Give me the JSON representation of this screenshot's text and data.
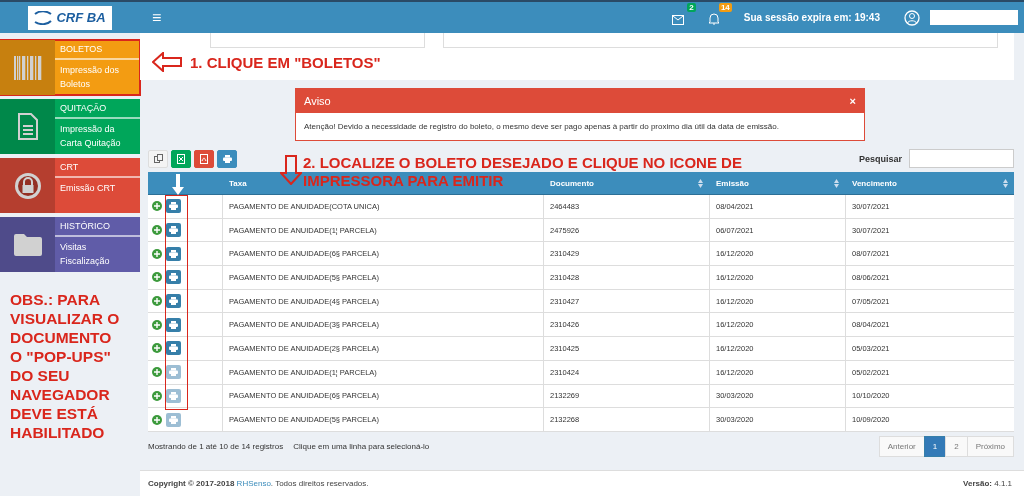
{
  "topbar": {
    "logo": "CRF BA",
    "menu_glyph": "≡",
    "mail_badge": "2",
    "bell_badge": "14",
    "session": "Sua sessão expira em: 19:43"
  },
  "sidebar": {
    "items": [
      {
        "kind": "barcode",
        "title": "BOLETOS",
        "subtitle": "Impressão dos Boletos",
        "color": "#f39c12",
        "highlighted": true
      },
      {
        "kind": "document",
        "title": "QUITAÇÃO",
        "subtitle": "Impressão da Carta Quitação",
        "color": "#00a65a",
        "highlighted": false
      },
      {
        "kind": "lock",
        "title": "CRT",
        "subtitle": "Emissão CRT",
        "color": "#dd4b39",
        "highlighted": false
      },
      {
        "kind": "folder",
        "title": "HISTÓRICO",
        "subtitle": "Visitas Fiscalização",
        "color": "#605ca8",
        "highlighted": false
      }
    ]
  },
  "annotations": {
    "step1": "1. CLIQUE EM \"BOLETOS\"",
    "step2": [
      "2. LOCALIZE O BOLETO DESEJADO E CLIQUE NO ICONE DE",
      "IMPRESSORA PARA EMITIR"
    ],
    "note": [
      "OBS.: PARA",
      "VISUALIZAR O",
      "DOCUMENTO",
      "O \"POP-UPS\"",
      "DO SEU",
      "NAVEGADOR",
      "DEVE ESTÁ",
      "HABILITADO"
    ]
  },
  "alert": {
    "title": "Aviso",
    "close": "×",
    "message": "Atenção! Devido a necessidade de registro do boleto, o mesmo deve ser pago apenas à partir do proximo dia útil da data de emissão."
  },
  "search": {
    "label": "Pesquisar"
  },
  "table": {
    "columns": [
      "Taxa",
      "Documento",
      "Emissão",
      "Vencimento"
    ],
    "rows": [
      {
        "taxa": "PAGAMENTO DE ANUIDADE(COTA UNICA)",
        "documento": "2464483",
        "emissao": "08/04/2021",
        "vencimento": "30/07/2021",
        "printable": true
      },
      {
        "taxa": "PAGAMENTO DE ANUIDADE(1¦ PARCELA)",
        "documento": "2475926",
        "emissao": "06/07/2021",
        "vencimento": "30/07/2021",
        "printable": true
      },
      {
        "taxa": "PAGAMENTO DE ANUIDADE(6§ PARCELA)",
        "documento": "2310429",
        "emissao": "16/12/2020",
        "vencimento": "08/07/2021",
        "printable": true
      },
      {
        "taxa": "PAGAMENTO DE ANUIDADE(5§ PARCELA)",
        "documento": "2310428",
        "emissao": "16/12/2020",
        "vencimento": "08/06/2021",
        "printable": true
      },
      {
        "taxa": "PAGAMENTO DE ANUIDADE(4§ PARCELA)",
        "documento": "2310427",
        "emissao": "16/12/2020",
        "vencimento": "07/05/2021",
        "printable": true
      },
      {
        "taxa": "PAGAMENTO DE ANUIDADE(3§ PARCELA)",
        "documento": "2310426",
        "emissao": "16/12/2020",
        "vencimento": "08/04/2021",
        "printable": true
      },
      {
        "taxa": "PAGAMENTO DE ANUIDADE(2§ PARCELA)",
        "documento": "2310425",
        "emissao": "16/12/2020",
        "vencimento": "05/03/2021",
        "printable": true
      },
      {
        "taxa": "PAGAMENTO DE ANUIDADE(1¦ PARCELA)",
        "documento": "2310424",
        "emissao": "16/12/2020",
        "vencimento": "05/02/2021",
        "printable": false
      },
      {
        "taxa": "PAGAMENTO DE ANUIDADE(6§ PARCELA)",
        "documento": "2132269",
        "emissao": "30/03/2020",
        "vencimento": "10/10/2020",
        "printable": false
      },
      {
        "taxa": "PAGAMENTO DE ANUIDADE(5§ PARCELA)",
        "documento": "2132268",
        "emissao": "30/03/2020",
        "vencimento": "10/09/2020",
        "printable": false
      }
    ]
  },
  "info": {
    "showing": "Mostrando de 1 até 10 de 14 registros",
    "hint": "Clique em uma linha para selecioná-lo"
  },
  "pagination": [
    {
      "label": "Anterior",
      "selected": false
    },
    {
      "label": "1",
      "selected": true
    },
    {
      "label": "2",
      "selected": false
    },
    {
      "label": "Próximo",
      "selected": false
    }
  ],
  "footer": {
    "copyright": "Copyright © 2017-2018",
    "brand": "RHSenso",
    "rights": ". Todos direitos reservados.",
    "version_label": "Versão:",
    "version": "4.1.1"
  }
}
